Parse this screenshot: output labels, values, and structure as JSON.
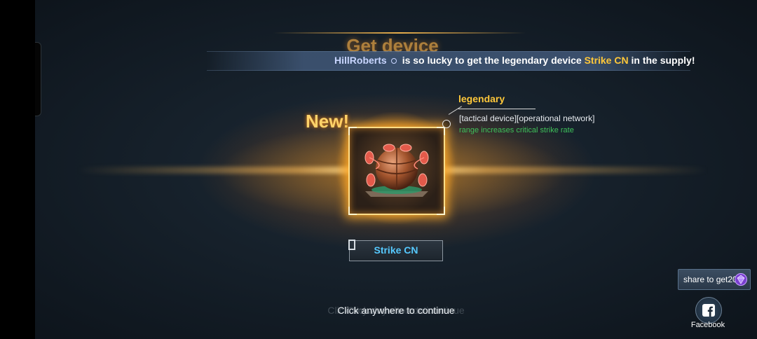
{
  "header": {
    "title": "Get device"
  },
  "announcement": {
    "username": "HillRoberts",
    "middle_text": "is so lucky to get the legendary device",
    "item_name": "Strike CN",
    "end_text": "in the supply!"
  },
  "reward": {
    "new_label": "New!",
    "rarity": "legendary",
    "tags": "[tactical device][operational network]",
    "effect": "range increases critical strike rate",
    "item_name": "Strike CN",
    "icon": "spherical-device-icon"
  },
  "footer": {
    "continue_text": "Click anywhere to continue"
  },
  "share": {
    "label": "share to get20",
    "icon": "purple-gem-icon"
  },
  "facebook": {
    "label": "Facebook",
    "icon": "facebook-icon"
  },
  "colors": {
    "accent_gold": "#ffc83a",
    "item_blue": "#56c9ff",
    "effect_green": "#3fc15a"
  }
}
